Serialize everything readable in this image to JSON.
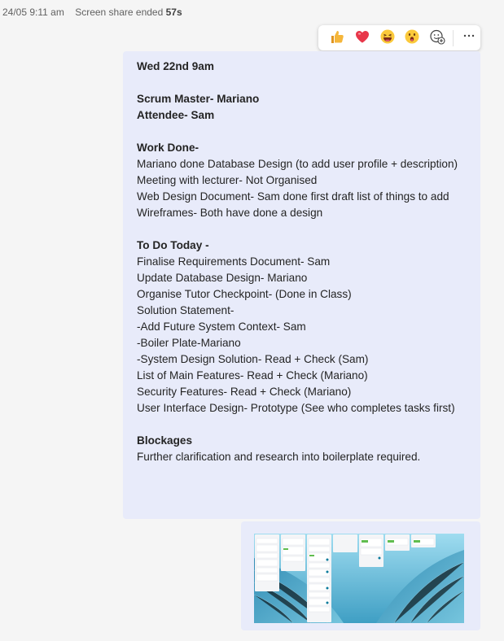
{
  "meta": {
    "timestamp": "24/05 9:11 am",
    "event_prefix": "Screen share ended",
    "event_duration": "57s"
  },
  "reactions": [
    {
      "name": "like",
      "glyph": "👍"
    },
    {
      "name": "heart",
      "glyph": "❤️"
    },
    {
      "name": "laugh",
      "glyph": "😆"
    },
    {
      "name": "surprised",
      "glyph": "😮"
    }
  ],
  "colors": {
    "bubble_bg": "#e8ebfa",
    "page_bg": "#f5f5f5",
    "like": "#f2a42b",
    "heart": "#e8374a"
  },
  "message": {
    "header": "Wed 22nd 9am",
    "scrum_master": "Scrum Master- Mariano",
    "attendee": "Attendee- Sam",
    "work_done_title": "Work Done-",
    "work_done": [
      "Mariano done Database Design (to add user profile + description)",
      "Meeting with lecturer- Not Organised",
      "Web Design Document- Sam done first draft list of things to add",
      "Wireframes- Both have done a design"
    ],
    "todo_title": "To Do Today -",
    "todo": [
      "Finalise Requirements Document- Sam",
      "Update Database Design- Mariano",
      "Organise Tutor Checkpoint- (Done in Class)",
      "Solution Statement-",
      "-Add Future System Context- Sam",
      "-Boiler Plate-Mariano",
      "-System Design Solution- Read + Check (Sam)",
      "List of Main Features- Read + Check (Mariano)",
      "Security Features- Read + Check (Mariano)",
      "User Interface Design- Prototype (See who completes tasks first)"
    ],
    "blockages_title": "Blockages",
    "blockages": "Further clarification and research into boilerplate required."
  },
  "attachment": {
    "icon": "screenshot-thumbnail"
  }
}
